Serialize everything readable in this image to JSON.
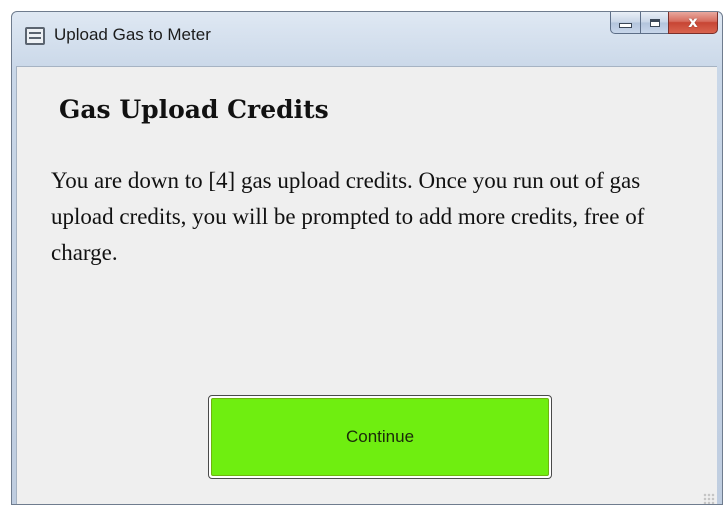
{
  "window": {
    "title": "Upload Gas to Meter",
    "icon": "window-app-icon",
    "controls": {
      "minimize_icon": "minimize-icon",
      "maximize_icon": "maximize-icon",
      "close_glyph": "x"
    }
  },
  "dialog": {
    "heading": "Gas Upload Credits",
    "message": "You are down to [4] gas upload credits. Once you run out of gas upload credits, you will be prompted to add more credits, free of charge.",
    "continue_label": "Continue"
  },
  "colors": {
    "continue_button": "#6fee10",
    "client_background": "#efefef",
    "close_button": "#c74534"
  }
}
